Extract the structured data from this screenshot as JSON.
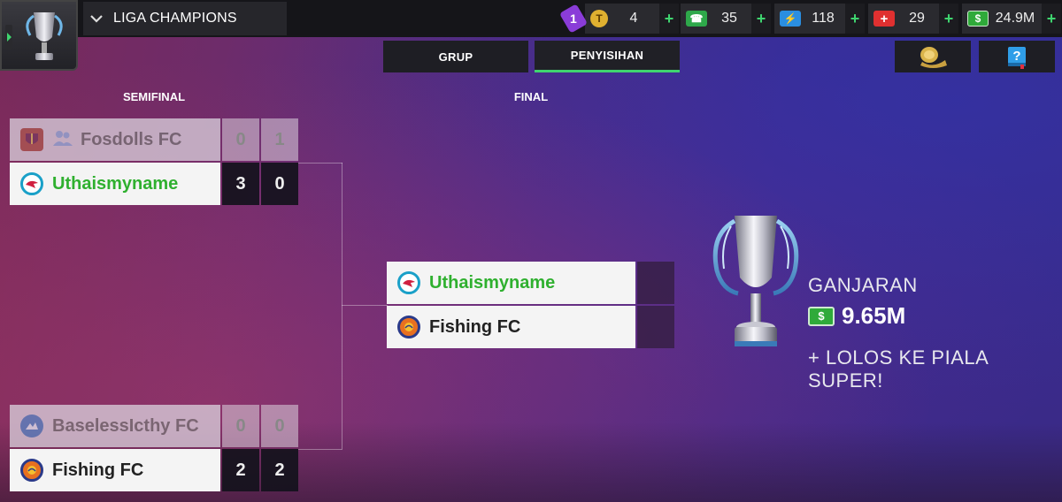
{
  "header": {
    "competition": "LIGA CHAMPIONS",
    "badge_count": "1",
    "resources": [
      {
        "name": "tokens",
        "icon": "token-icon",
        "value": "4"
      },
      {
        "name": "support",
        "icon": "support-icon",
        "value": "35"
      },
      {
        "name": "energy",
        "icon": "energy-icon",
        "value": "118"
      },
      {
        "name": "health",
        "icon": "health-icon",
        "value": "29"
      },
      {
        "name": "cash",
        "icon": "cash-icon",
        "value": "24.9M"
      }
    ],
    "plus_label": "+"
  },
  "tabs": [
    {
      "label": "GRUP",
      "active": false
    },
    {
      "label": "PENYISIHAN",
      "active": true
    }
  ],
  "rounds": {
    "semifinal": "SEMIFINAL",
    "final": "FINAL"
  },
  "semifinal_1": {
    "team_a": {
      "name": "Fosdolls FC",
      "scores": [
        "0",
        "1"
      ],
      "state": "eliminated"
    },
    "team_b": {
      "name": "Uthaismyname",
      "scores": [
        "3",
        "0"
      ],
      "state": "winner"
    }
  },
  "semifinal_2": {
    "team_a": {
      "name": "BaselessIcthy FC",
      "scores": [
        "0",
        "0"
      ],
      "state": "eliminated"
    },
    "team_b": {
      "name": "Fishing FC",
      "scores": [
        "2",
        "2"
      ],
      "state": "advanced"
    }
  },
  "final": {
    "team_a": {
      "name": "Uthaismyname",
      "score": ""
    },
    "team_b": {
      "name": "Fishing FC",
      "score": ""
    }
  },
  "reward": {
    "title": "GANJARAN",
    "currency_symbol": "$",
    "amount": "9.65M",
    "extra": "+ LOLOS KE PIALA SUPER!"
  },
  "colors": {
    "accent_green": "#3fd56f",
    "winner_text": "#2fb02f",
    "badge_purple": "#8a3cd8"
  }
}
